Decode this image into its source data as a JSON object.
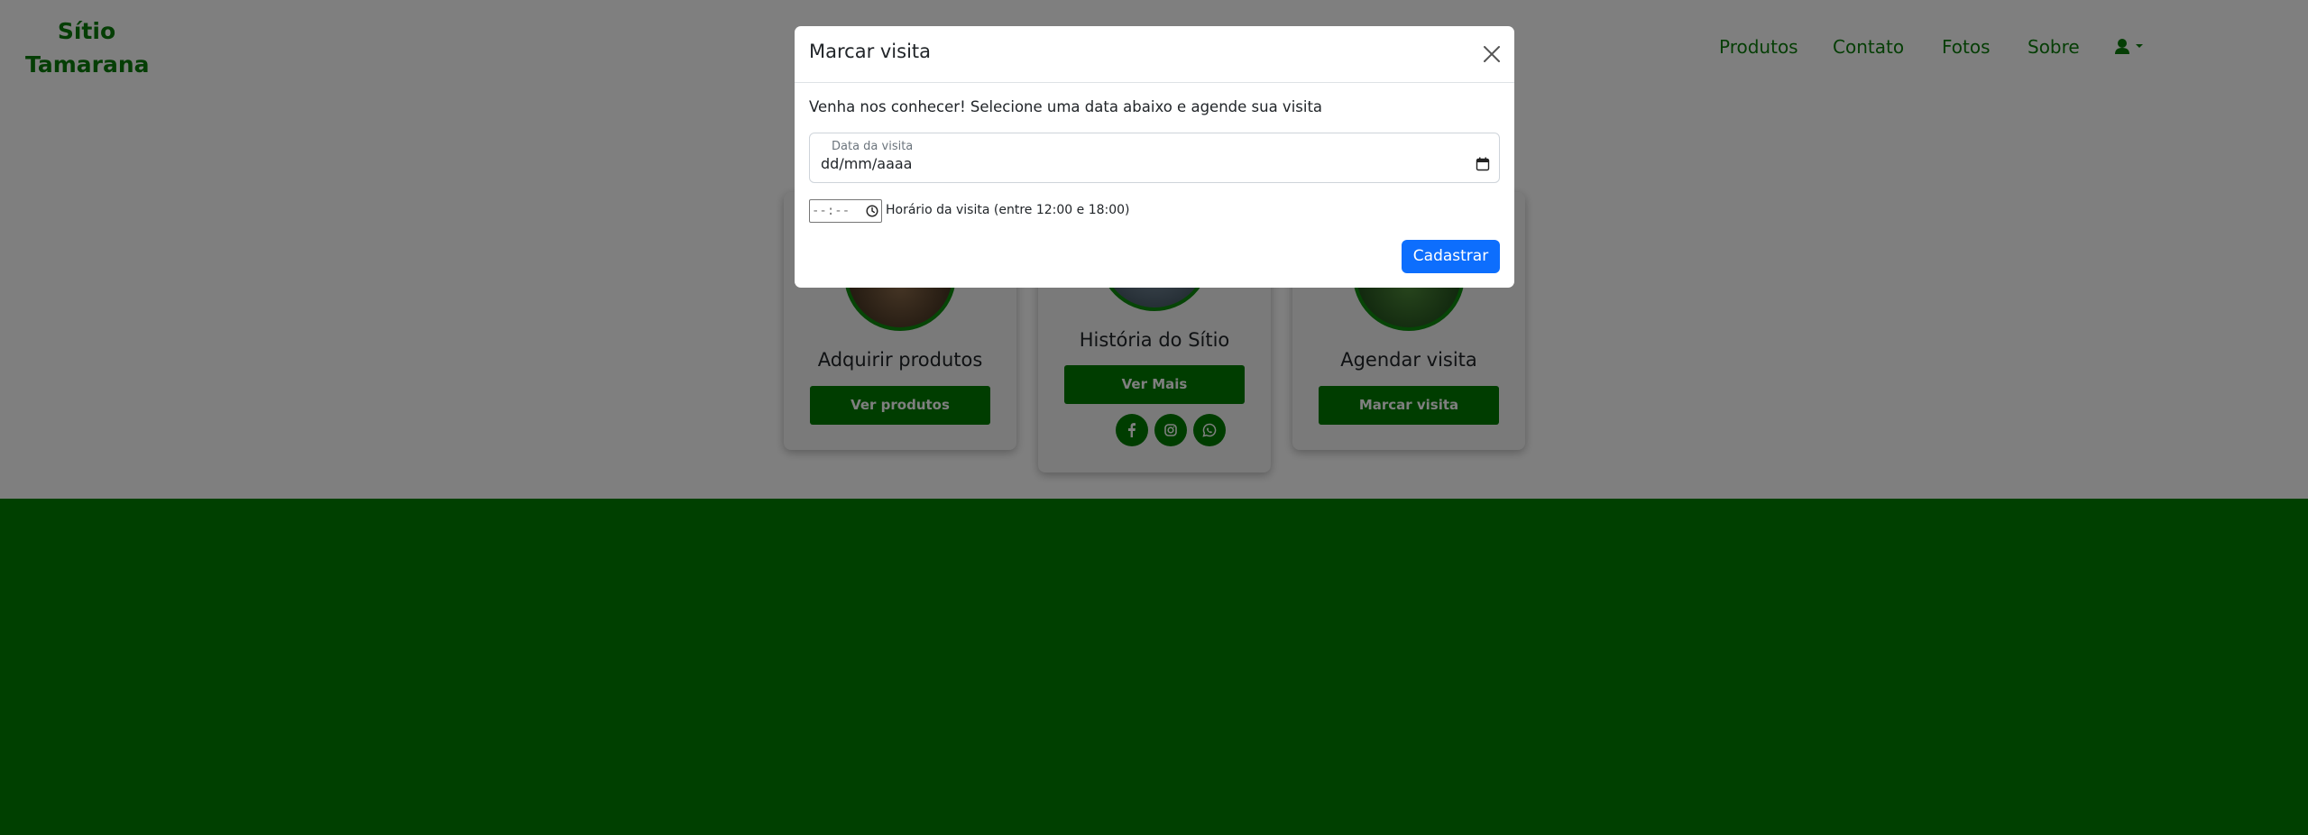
{
  "navbar": {
    "brand_line1": "Sítio",
    "brand_line2": "Tamarana",
    "links": [
      "Produtos",
      "Contato",
      "Fotos",
      "Sobre"
    ],
    "user_icon": "user-icon",
    "caret_icon": "caret-down-icon"
  },
  "cards": [
    {
      "title": "Adquirir produtos",
      "button": "Ver produtos"
    },
    {
      "title": "História do Sítio",
      "button": "Ver Mais",
      "social_icons": [
        "facebook-icon",
        "instagram-icon",
        "whatsapp-icon"
      ]
    },
    {
      "title": "Agendar visita",
      "button": "Marcar visita"
    }
  ],
  "modal": {
    "title": "Marcar visita",
    "close_icon": "close-icon",
    "text": "Venha nos conhecer! Selecione uma data abaixo e agende sua visita",
    "date_label": "Data da visita",
    "date_placeholder": "dd/mm/aaaa",
    "time_placeholder": "--:--",
    "time_label": "Horário da visita (entre 12:00 e 18:00)",
    "submit": "Cadastrar"
  },
  "colors": {
    "brand_green": "#0b7d0b",
    "button_green": "#007a00",
    "footer_green": "#008000",
    "primary_blue": "#0d6efd"
  }
}
